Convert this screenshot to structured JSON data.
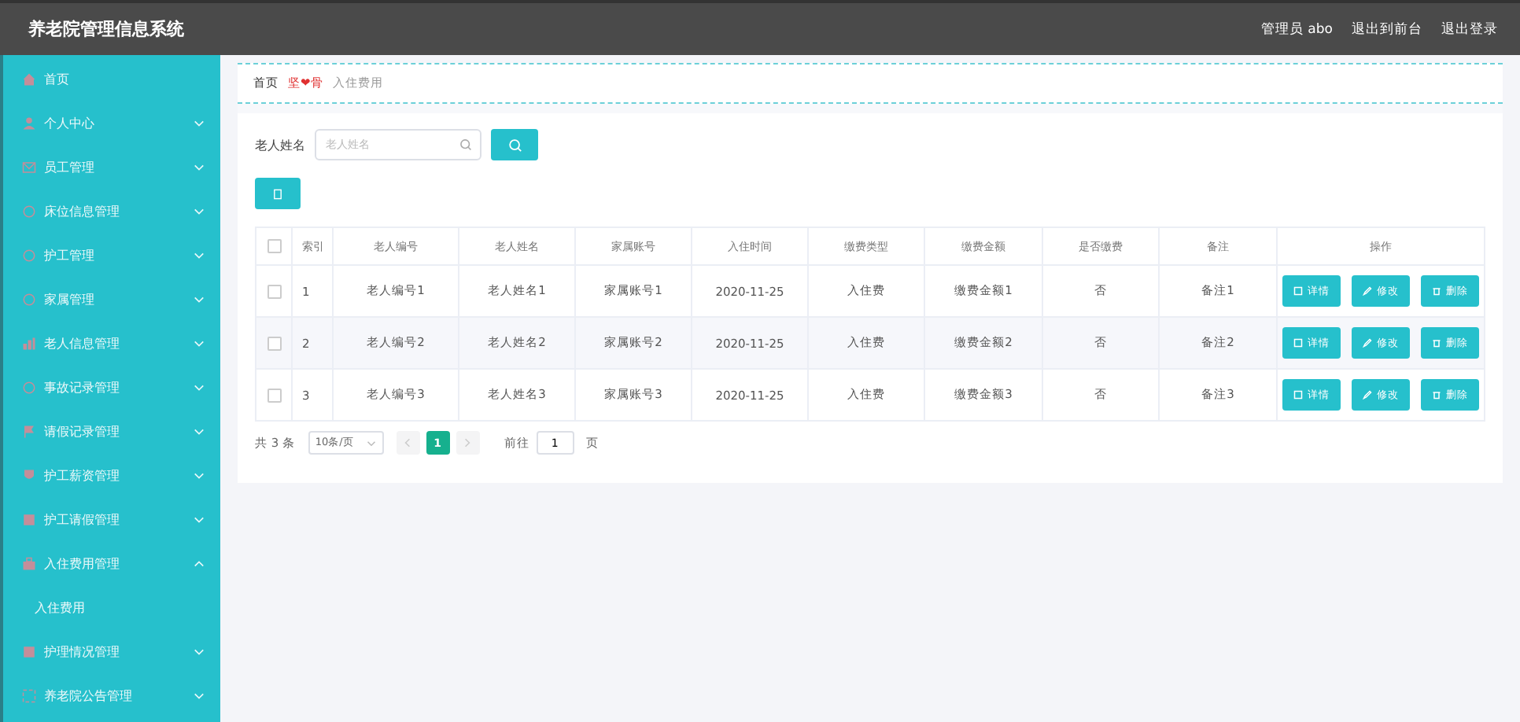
{
  "header": {
    "title": "养老院管理信息系统",
    "user": "管理员 abo",
    "links": [
      "退出到前台",
      "退出登录"
    ]
  },
  "sidebar": {
    "items": [
      {
        "label": "首页",
        "kind": "link"
      },
      {
        "label": "个人中心",
        "kind": "menu",
        "expanded": false
      },
      {
        "label": "员工管理",
        "kind": "menu",
        "expanded": false
      },
      {
        "label": "床位信息管理",
        "kind": "menu",
        "expanded": false
      },
      {
        "label": "护工管理",
        "kind": "menu",
        "expanded": false
      },
      {
        "label": "家属管理",
        "kind": "menu",
        "expanded": false
      },
      {
        "label": "老人信息管理",
        "kind": "menu",
        "expanded": false
      },
      {
        "label": "事故记录管理",
        "kind": "menu",
        "expanded": false
      },
      {
        "label": "请假记录管理",
        "kind": "menu",
        "expanded": false
      },
      {
        "label": "护工薪资管理",
        "kind": "menu",
        "expanded": false
      },
      {
        "label": "护工请假管理",
        "kind": "menu",
        "expanded": false
      },
      {
        "label": "入住费用管理",
        "kind": "menu",
        "expanded": true,
        "children": [
          {
            "label": "入住费用"
          }
        ]
      },
      {
        "label": "护理情况管理",
        "kind": "menu",
        "expanded": false
      },
      {
        "label": "养老院公告管理",
        "kind": "menu",
        "expanded": false
      }
    ]
  },
  "breadcrumb": [
    "首页",
    "坚❤骨",
    "入住费用"
  ],
  "search": {
    "label": "老人姓名",
    "placeholder": "老人姓名"
  },
  "table": {
    "all_checked": false,
    "columns": [
      "索引",
      "老人编号",
      "老人姓名",
      "家属账号",
      "入住时间",
      "缴费类型",
      "缴费金额",
      "是否缴费",
      "备注",
      "操作"
    ],
    "rows": [
      {
        "checked": false,
        "cells": [
          "1",
          "老人编号1",
          "老人姓名1",
          "家属账号1",
          "2020-11-25",
          "入住费",
          "缴费金额1",
          "否",
          "备注1"
        ],
        "actions": [
          "详情",
          "修改",
          "删除"
        ]
      },
      {
        "checked": false,
        "cells": [
          "2",
          "老人编号2",
          "老人姓名2",
          "家属账号2",
          "2020-11-25",
          "入住费",
          "缴费金额2",
          "否",
          "备注2"
        ],
        "actions": [
          "详情",
          "修改",
          "删除"
        ]
      },
      {
        "checked": false,
        "cells": [
          "3",
          "老人编号3",
          "老人姓名3",
          "家属账号3",
          "2020-11-25",
          "入住费",
          "缴费金额3",
          "否",
          "备注3"
        ],
        "actions": [
          "详情",
          "修改",
          "删除"
        ]
      }
    ]
  },
  "pagination": {
    "total": "共 3 条",
    "page_size": "10条/页",
    "pages": [
      {
        "label": "1",
        "selected": true
      }
    ],
    "goto_label": "前往",
    "goto_value": "1",
    "goto_unit": "页"
  }
}
